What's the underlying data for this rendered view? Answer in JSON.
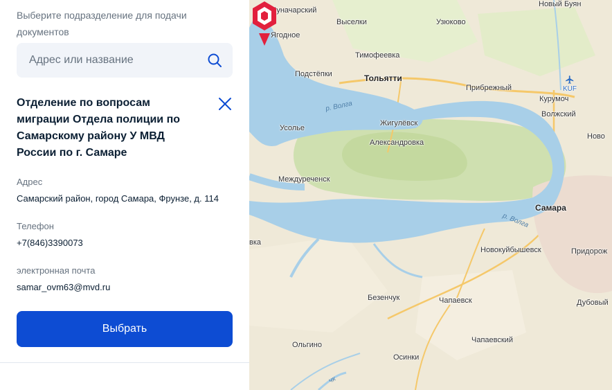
{
  "panel": {
    "intro": "Выберите подразделение для подачи документов",
    "search": {
      "placeholder": "Адрес или название",
      "value": ""
    },
    "office": {
      "title": "Отделение по вопросам миграции Отдела полиции по Самарскому району У МВД России по г. Самаре",
      "address_label": "Адрес",
      "address": "Самарский район, город Самара, Фрунзе, д. 114",
      "phone_label": "Телефон",
      "phone": "+7(846)3390073",
      "email_label": "электронная почта",
      "email": "samar_ovm63@mvd.ru"
    },
    "select_button": "Выбрать"
  },
  "map": {
    "labels": [
      {
        "id": "lunacharsky",
        "text": "Луначарский"
      },
      {
        "id": "vyselki",
        "text": "Выселки"
      },
      {
        "id": "uzyukovo",
        "text": "Узюково"
      },
      {
        "id": "novy-buyan",
        "text": "Новый Буян"
      },
      {
        "id": "yagodnoe",
        "text": "Ягодное"
      },
      {
        "id": "timofeevka",
        "text": "Тимофеевка"
      },
      {
        "id": "podstepki",
        "text": "Подстёпки"
      },
      {
        "id": "tolyatti",
        "text": "Тольятти"
      },
      {
        "id": "pribrezhny",
        "text": "Прибрежный"
      },
      {
        "id": "kurumoch",
        "text": "Курумоч"
      },
      {
        "id": "volzhsky",
        "text": "Волжский"
      },
      {
        "id": "novo",
        "text": "Ново"
      },
      {
        "id": "usolye",
        "text": "Усолье"
      },
      {
        "id": "zhigulevsk",
        "text": "Жигулёвск"
      },
      {
        "id": "aleksandrovka",
        "text": "Александровка"
      },
      {
        "id": "mezhdurechensk",
        "text": "Междуреченск"
      },
      {
        "id": "samara",
        "text": "Самара"
      },
      {
        "id": "vka",
        "text": "вка"
      },
      {
        "id": "novokuibyshevsk",
        "text": "Новокуйбышевск"
      },
      {
        "id": "pridorozh",
        "text": "Придорож"
      },
      {
        "id": "bezenchuk",
        "text": "Безенчук"
      },
      {
        "id": "chapaevsk",
        "text": "Чапаевск"
      },
      {
        "id": "dubovy",
        "text": "Дубовый"
      },
      {
        "id": "olgino",
        "text": "Ольгино"
      },
      {
        "id": "chapaevsky",
        "text": "Чапаевский"
      },
      {
        "id": "osinki",
        "text": "Осинки"
      }
    ],
    "rivers": [
      {
        "id": "volga-1",
        "text": "р. Волга"
      },
      {
        "id": "volga-2",
        "text": "р. Волга"
      },
      {
        "id": "chk",
        "text": "чк"
      }
    ],
    "airport_code": "KUF",
    "colors": {
      "water": "#a8cfe8",
      "forest": "#cfe0b0",
      "land": "#efe9d8",
      "marker": "#e2203d",
      "accent": "#0d4cd3"
    }
  }
}
